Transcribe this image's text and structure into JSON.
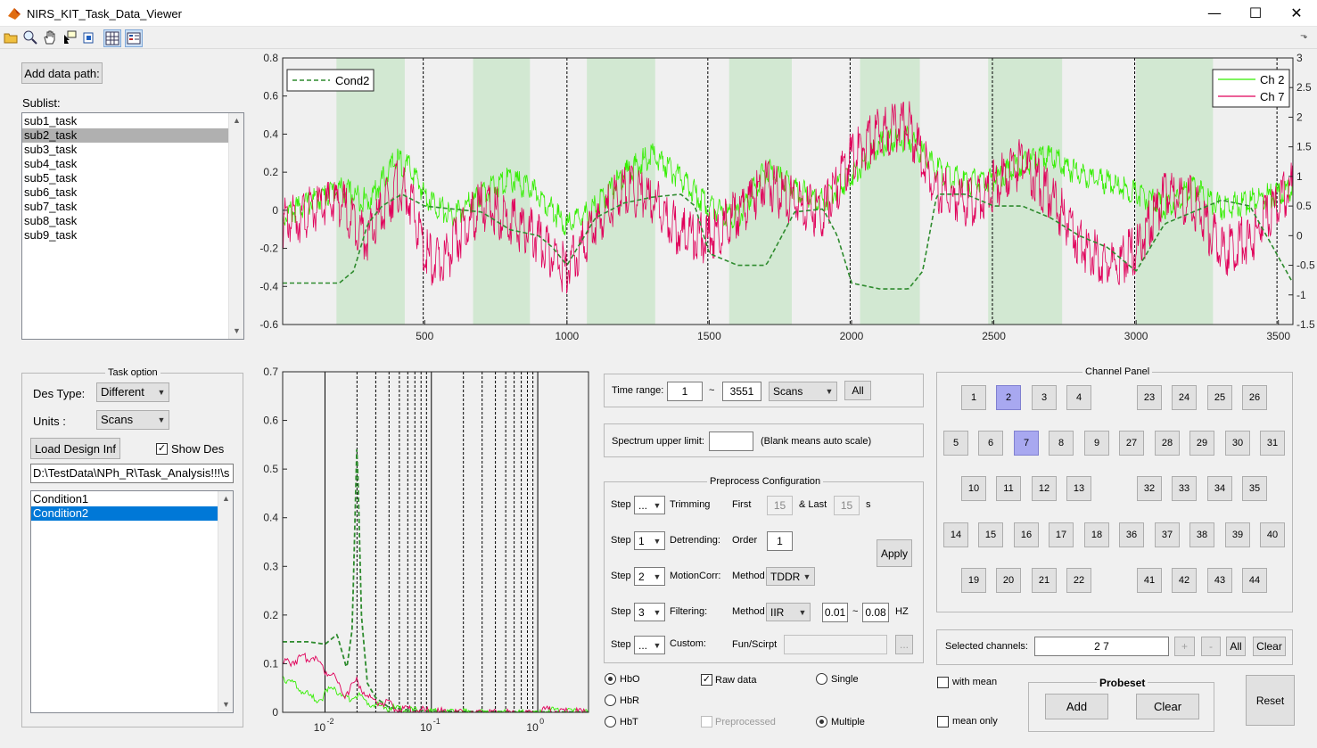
{
  "window": {
    "title": "NIRS_KIT_Task_Data_Viewer",
    "minimize": "—",
    "maximize": "☐",
    "close": "✕"
  },
  "left_top": {
    "add_path_label": "Add data path:",
    "sublist_label": "Sublist:",
    "subjects": [
      "sub1_task",
      "sub2_task",
      "sub3_task",
      "sub4_task",
      "sub5_task",
      "sub6_task",
      "sub7_task",
      "sub8_task",
      "sub9_task"
    ],
    "selected_subject": "sub2_task"
  },
  "task_option": {
    "title": "Task option",
    "des_type_label": "Des Type:",
    "des_type_value": "Different",
    "units_label": "Units :",
    "units_value": "Scans",
    "load_label": "Load Design Inf",
    "show_des_label": "Show Des",
    "show_des_checked": true,
    "path_value": "D:\\TestData\\NPh_R\\Task_Analysis!!!\\s",
    "conditions": [
      "Condition1",
      "Condition2"
    ],
    "selected_condition": "Condition2"
  },
  "time_range": {
    "label": "Time range:",
    "from": "1",
    "sep": "~",
    "to": "3551",
    "unit": "Scans",
    "all_label": "All"
  },
  "spectrum": {
    "label": "Spectrum upper limit:",
    "value": "",
    "hint": "(Blank means auto scale)"
  },
  "preprocess": {
    "title": "Preprocess Configuration",
    "step_label": "Step",
    "rows": [
      {
        "step": "...",
        "name": "Trimming",
        "p1": "First",
        "v1": "15",
        "p2": "& Last",
        "v2": "15",
        "unit": "s"
      },
      {
        "step": "1",
        "name": "Detrending:",
        "p1": "Order",
        "v1": "1"
      },
      {
        "step": "2",
        "name": "MotionCorr:",
        "p1": "Method",
        "v1": "TDDR"
      },
      {
        "step": "3",
        "name": "Filtering:",
        "p1": "Method",
        "v1": "IIR",
        "low": "0.01",
        "sep": "~",
        "high": "0.08",
        "unit": "HZ"
      },
      {
        "step": "...",
        "name": "Custom:",
        "p1": "Fun/Scirpt",
        "browse": "..."
      }
    ],
    "apply_label": "Apply"
  },
  "signal_opts": {
    "hbo": "HbO",
    "hbr": "HbR",
    "hbt": "HbT",
    "selected_hb": "HbO",
    "raw": "Raw data",
    "raw_checked": true,
    "preprocessed": "Preprocessed",
    "preprocessed_checked": false,
    "single": "Single",
    "multiple": "Multiple",
    "selected_mode": "Multiple"
  },
  "channel_panel": {
    "title": "Channel Panel",
    "selected": [
      2,
      7
    ]
  },
  "selected_channels": {
    "label": "Selected channels:",
    "value": "2  7",
    "plus": "+",
    "minus": "-",
    "all_label": "All",
    "clear_label": "Clear"
  },
  "mean_opts": {
    "with_mean": "with mean",
    "mean_only": "mean only"
  },
  "probeset": {
    "title": "Probeset",
    "add_label": "Add",
    "clear_label": "Clear"
  },
  "reset_label": "Reset",
  "colors": {
    "hbo_ch2": "#33ee00",
    "hbo_ch7": "#e0005a",
    "design": "#2e8b2e",
    "block": "#d2e8d2"
  },
  "chart_data": [
    {
      "type": "line",
      "title": "",
      "xlabel": "",
      "ylabel": "",
      "xlim": [
        1,
        3551
      ],
      "ylim": [
        -0.6,
        0.8
      ],
      "y2lim": [
        -1.5,
        3
      ],
      "x_ticks": [
        500,
        1000,
        1500,
        2000,
        2500,
        3000,
        3500
      ],
      "y_ticks": [
        -0.6,
        -0.4,
        -0.2,
        0,
        0.2,
        0.4,
        0.6,
        0.8
      ],
      "y2_ticks": [
        -1.5,
        -1,
        -0.5,
        0,
        0.5,
        1,
        1.5,
        2,
        2.5,
        3
      ],
      "legend_left": [
        "Cond2"
      ],
      "legend_right": [
        "Ch 2",
        "Ch 7"
      ],
      "blocks": [
        [
          190,
          430
        ],
        [
          670,
          870
        ],
        [
          1070,
          1310
        ],
        [
          1570,
          1790
        ],
        [
          2030,
          2240
        ],
        [
          2480,
          2740
        ],
        [
          3000,
          3270
        ]
      ],
      "markers": [
        495,
        1000,
        1495,
        1995,
        2495,
        2995,
        3495
      ],
      "series": [
        {
          "name": "Ch 2",
          "x": [
            1,
            100,
            200,
            300,
            400,
            450,
            500,
            550,
            600,
            700,
            800,
            900,
            1000,
            1100,
            1200,
            1300,
            1400,
            1500,
            1600,
            1700,
            1800,
            1900,
            2000,
            2100,
            2200,
            2300,
            2400,
            2500,
            2600,
            2700,
            2800,
            2900,
            3000,
            3100,
            3200,
            3300,
            3400,
            3551
          ],
          "y": [
            0.0,
            0.08,
            0.15,
            0.08,
            0.3,
            0.25,
            0.12,
            0.05,
            0.0,
            0.12,
            0.2,
            0.12,
            -0.05,
            0.05,
            0.22,
            0.33,
            0.2,
            0.05,
            0.0,
            0.25,
            0.15,
            0.08,
            0.22,
            0.38,
            0.42,
            0.25,
            0.18,
            0.2,
            0.28,
            0.32,
            0.22,
            0.18,
            0.12,
            0.05,
            0.15,
            0.05,
            0.08,
            0.15
          ]
        },
        {
          "name": "Ch 7",
          "x": [
            1,
            100,
            200,
            300,
            400,
            450,
            500,
            550,
            600,
            700,
            800,
            900,
            1000,
            1100,
            1200,
            1300,
            1400,
            1500,
            1600,
            1700,
            1800,
            1900,
            2000,
            2100,
            2200,
            2300,
            2400,
            2500,
            2600,
            2700,
            2800,
            2900,
            3000,
            3100,
            3200,
            3300,
            3400,
            3551
          ],
          "y": [
            0.0,
            0.06,
            0.12,
            -0.08,
            0.2,
            0.12,
            -0.15,
            -0.22,
            -0.12,
            0.1,
            0.02,
            -0.08,
            -0.25,
            0.0,
            0.18,
            0.12,
            -0.05,
            -0.08,
            0.05,
            0.22,
            0.1,
            0.05,
            0.35,
            0.48,
            0.52,
            0.18,
            0.1,
            0.2,
            0.32,
            0.15,
            -0.1,
            -0.22,
            -0.15,
            0.15,
            0.12,
            -0.15,
            -0.08,
            0.2
          ]
        },
        {
          "name": "Cond2",
          "axis": "right",
          "x": [
            1,
            200,
            250,
            300,
            350,
            420,
            500,
            600,
            700,
            800,
            900,
            950,
            1000,
            1100,
            1200,
            1300,
            1400,
            1450,
            1500,
            1600,
            1700,
            1800,
            1900,
            1950,
            2000,
            2100,
            2200,
            2250,
            2300,
            2400,
            2500,
            2600,
            2700,
            2800,
            2900,
            3000,
            3100,
            3200,
            3300,
            3400,
            3551
          ],
          "y": [
            -0.8,
            -0.8,
            -0.6,
            0.2,
            0.5,
            0.7,
            0.5,
            0.45,
            0.4,
            0.1,
            0.0,
            -0.2,
            -0.5,
            0.3,
            0.55,
            0.65,
            0.7,
            0.5,
            -0.3,
            -0.5,
            -0.5,
            0.4,
            0.45,
            0.0,
            -0.8,
            -0.9,
            -0.9,
            -0.6,
            0.7,
            0.7,
            0.5,
            0.5,
            0.3,
            0.0,
            -0.2,
            -0.6,
            0.2,
            0.4,
            0.6,
            0.5,
            -0.8
          ]
        }
      ]
    },
    {
      "type": "line",
      "title": "",
      "xlabel": "",
      "ylabel": "",
      "xscale": "log",
      "xlim": [
        0.004,
        3
      ],
      "ylim": [
        0,
        0.7
      ],
      "x_ticks": [
        "10",
        "10",
        "10"
      ],
      "x_tick_exponents": [
        "-2",
        "-1",
        "0"
      ],
      "y_ticks": [
        0,
        0.1,
        0.2,
        0.3,
        0.4,
        0.5,
        0.6,
        0.7
      ],
      "solid_markers": [
        0.01,
        0.1,
        1
      ],
      "dashed_markers": [
        0.02,
        0.03,
        0.04,
        0.05,
        0.06,
        0.07,
        0.08,
        0.09,
        0.2,
        0.3,
        0.4,
        0.5,
        0.6,
        0.7,
        0.8,
        0.9
      ],
      "series": [
        {
          "name": "design",
          "x": [
            0.004,
            0.007,
            0.01,
            0.013,
            0.016,
            0.018,
            0.02,
            0.022,
            0.025,
            0.03,
            0.04,
            0.06,
            0.1,
            0.2,
            1,
            3
          ],
          "y": [
            0.145,
            0.145,
            0.14,
            0.16,
            0.09,
            0.17,
            0.56,
            0.2,
            0.06,
            0.03,
            0.01,
            0.005,
            0.003,
            0.002,
            0.001,
            0.001
          ]
        },
        {
          "name": "Ch 2",
          "x": [
            0.004,
            0.006,
            0.008,
            0.01,
            0.012,
            0.015,
            0.02,
            0.025,
            0.03,
            0.05,
            0.1,
            0.2,
            0.5,
            1,
            1.2,
            3
          ],
          "y": [
            0.08,
            0.05,
            0.03,
            0.04,
            0.06,
            0.03,
            0.04,
            0.025,
            0.02,
            0.01,
            0.005,
            0.003,
            0.002,
            0.002,
            0.008,
            0.002
          ]
        },
        {
          "name": "Ch 7",
          "x": [
            0.004,
            0.006,
            0.008,
            0.01,
            0.012,
            0.015,
            0.02,
            0.025,
            0.03,
            0.05,
            0.1,
            0.2,
            0.5,
            1,
            1.2,
            3
          ],
          "y": [
            0.105,
            0.115,
            0.12,
            0.09,
            0.085,
            0.04,
            0.07,
            0.035,
            0.03,
            0.012,
            0.006,
            0.003,
            0.002,
            0.002,
            0.01,
            0.002
          ]
        }
      ]
    }
  ]
}
